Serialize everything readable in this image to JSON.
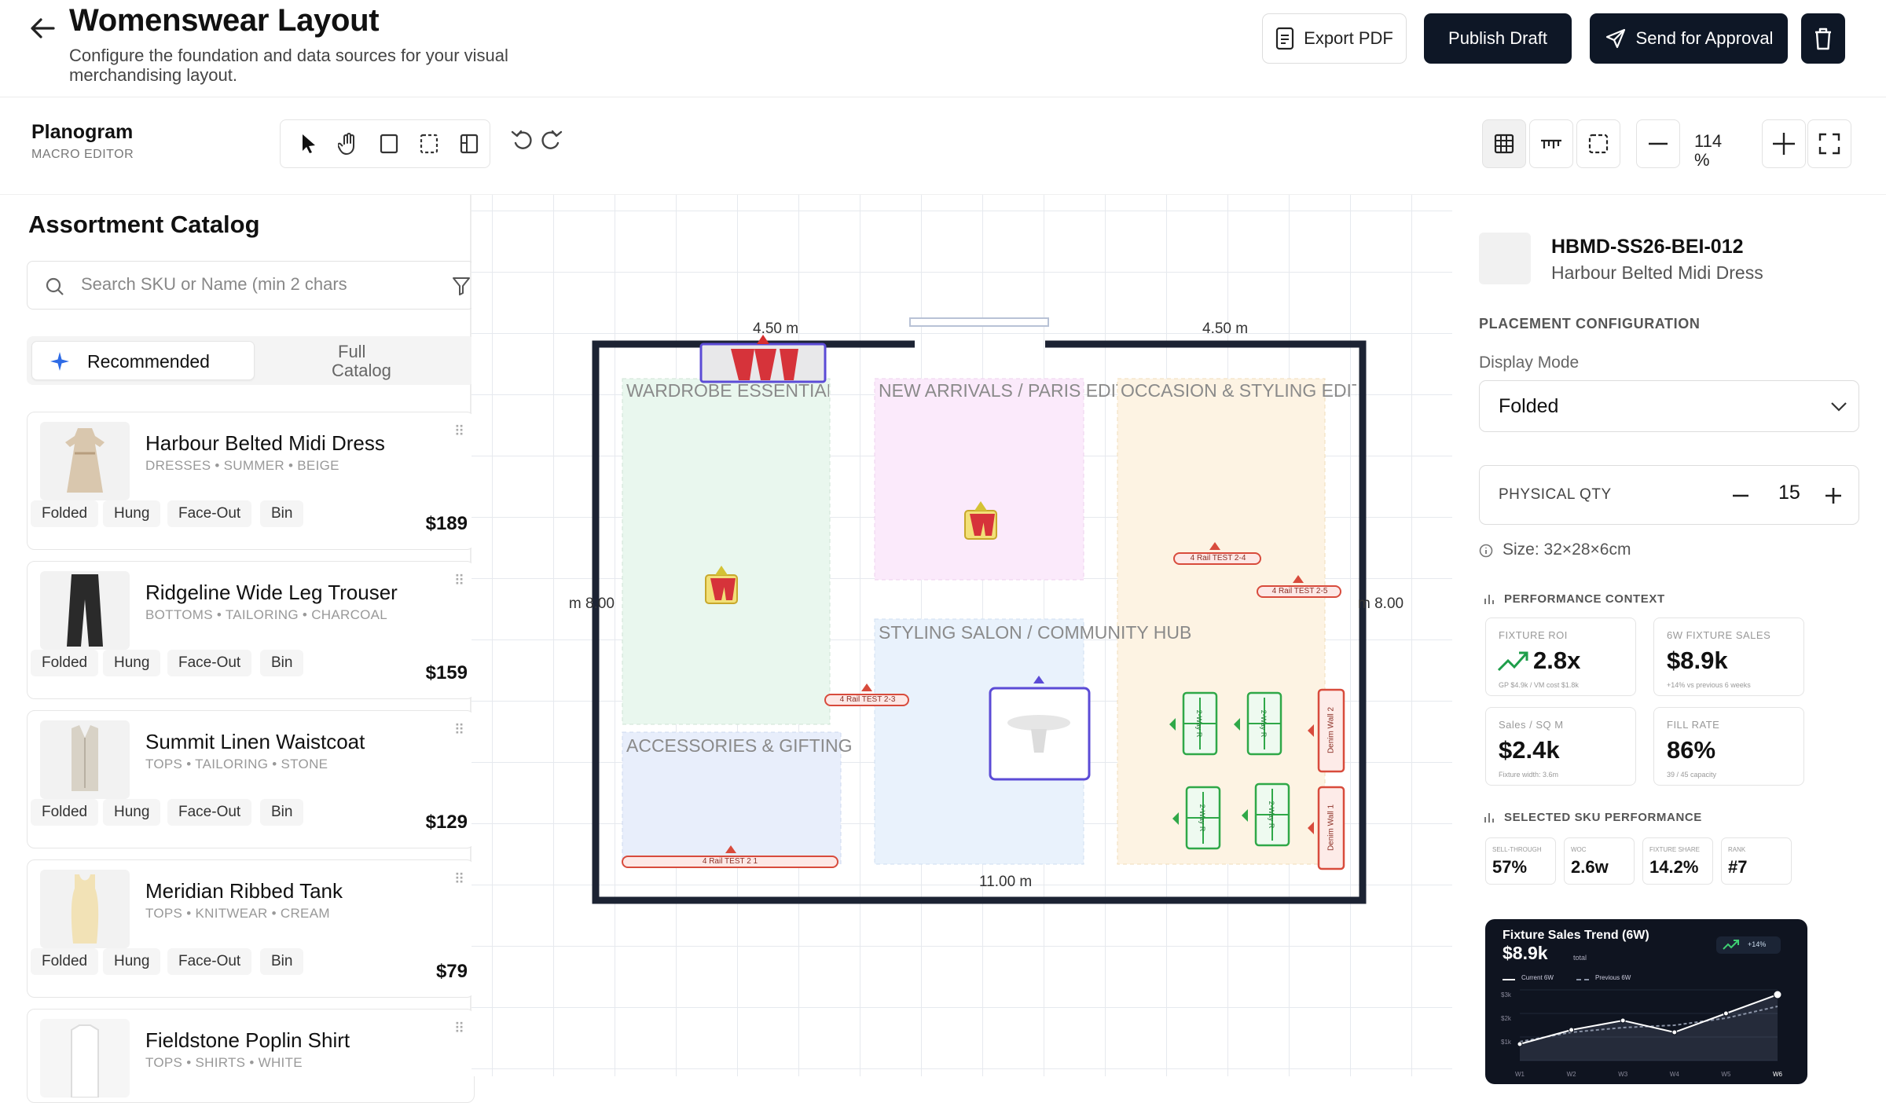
{
  "header": {
    "title": "Womenswear Layout",
    "subtitle": "Configure the foundation and data sources for your visual merchandising layout.",
    "export_label": "Export PDF",
    "publish_label": "Publish Draft",
    "approval_label": "Send for Approval"
  },
  "toolbar": {
    "title": "Planogram",
    "subtitle": "MACRO EDITOR",
    "zoom_value": "114",
    "zoom_unit": "%"
  },
  "catalog": {
    "title": "Assortment Catalog",
    "search_placeholder": "Search SKU or Name (min 2 chars",
    "tab_recommended": "Recommended",
    "tab_full_1": "Full",
    "tab_full_2": "Catalog",
    "items": [
      {
        "name": "Harbour Belted Midi Dress",
        "meta": "DRESSES • SUMMER • BEIGE",
        "price": "$189",
        "chips": [
          "Folded",
          "Hung",
          "Face-Out",
          "Bin"
        ]
      },
      {
        "name": "Ridgeline Wide Leg Trouser",
        "meta": "BOTTOMS • TAILORING • CHARCOAL",
        "price": "$159",
        "chips": [
          "Folded",
          "Hung",
          "Face-Out",
          "Bin"
        ]
      },
      {
        "name": "Summit Linen Waistcoat",
        "meta": "TOPS • TAILORING • STONE",
        "price": "$129",
        "chips": [
          "Folded",
          "Hung",
          "Face-Out",
          "Bin"
        ]
      },
      {
        "name": "Meridian Ribbed Tank",
        "meta": "TOPS • KNITWEAR • CREAM",
        "price": "$79",
        "chips": [
          "Folded",
          "Hung",
          "Face-Out",
          "Bin"
        ]
      },
      {
        "name": "Fieldstone Poplin Shirt",
        "meta": "TOPS • SHIRTS • WHITE",
        "price": "",
        "chips": []
      }
    ]
  },
  "floorplan": {
    "dim_top_left": "4.50 m",
    "dim_top_right": "4.50 m",
    "dim_left": "8.00 m",
    "dim_right": "8.00 m",
    "dim_bottom": "11.00 m",
    "zones": [
      {
        "label": "WARDROBE ESSENTIALS",
        "color": "#e9f7ee"
      },
      {
        "label": "NEW ARRIVALS / PARIS EDIT",
        "color": "#fbeafb"
      },
      {
        "label": "OCCASION & STYLING EDIT",
        "color": "#fdf3e3"
      },
      {
        "label": "STYLING SALON / COMMUNITY HUB",
        "color": "#e9f2fc"
      },
      {
        "label": "ACCESSORIES & GIFTING",
        "color": "#e8eefb"
      }
    ],
    "rails": [
      "4 Rail TEST 2-4",
      "4 Rail TEST 2-5",
      "4 Rail TEST 2-3",
      "4 Rail TEST 2 1"
    ],
    "walls": [
      "Denim Wall 2",
      "Denim Wall 1"
    ],
    "racks": [
      "2-Way R",
      "2-Way R",
      "2-Way R",
      "2-Way R"
    ]
  },
  "details": {
    "sku_code": "HBMD-SS26-BEI-012",
    "sku_name": "Harbour Belted Midi Dress",
    "placement_title": "PLACEMENT CONFIGURATION",
    "display_mode_label": "Display Mode",
    "display_mode_value": "Folded",
    "qty_label": "PHYSICAL QTY",
    "qty_value": "15",
    "size_text": "Size: 32×28×6cm",
    "perf_title": "PERFORMANCE CONTEXT",
    "kpis": [
      {
        "label": "FIXTURE ROI",
        "value": "2.8x",
        "note": "GP $4.9k / VM cost $1.8k"
      },
      {
        "label": "6W FIXTURE SALES",
        "value": "$8.9k",
        "note": "+14% vs previous 6 weeks"
      },
      {
        "label": "Sales / SQ M",
        "value": "$2.4k",
        "note": "Fixture width: 3.6m"
      },
      {
        "label": "FILL RATE",
        "value": "86%",
        "note": "39 / 45 capacity"
      }
    ],
    "sku_perf_title": "SELECTED SKU PERFORMANCE",
    "sku_perf": [
      {
        "label": "SELL-THROUGH",
        "value": "57%"
      },
      {
        "label": "WOC",
        "value": "2.6w"
      },
      {
        "label": "FIXTURE SHARE",
        "value": "14.2%"
      },
      {
        "label": "RANK",
        "value": "#7"
      }
    ],
    "trend": {
      "title": "Fixture Sales Trend (6W)",
      "value": "$8.9k",
      "value_suffix": "total",
      "badge": "+14%",
      "legend_current": "Current 6W",
      "legend_previous": "Previous 6W",
      "yticks": [
        "$3k",
        "$2k",
        "$1k"
      ]
    }
  },
  "chart_data": {
    "type": "line",
    "title": "Fixture Sales Trend (6W)",
    "categories": [
      "W1",
      "W2",
      "W3",
      "W4",
      "W5",
      "W6"
    ],
    "series": [
      {
        "name": "Current 6W",
        "values": [
          0.7,
          1.3,
          1.7,
          1.2,
          2.0,
          2.8
        ]
      },
      {
        "name": "Previous 6W",
        "values": [
          0.8,
          1.2,
          1.4,
          1.5,
          1.8,
          2.3
        ]
      }
    ],
    "ylim": [
      0,
      3
    ],
    "colors": {
      "current": "#ffffff",
      "previous": "#8a93a6"
    }
  }
}
